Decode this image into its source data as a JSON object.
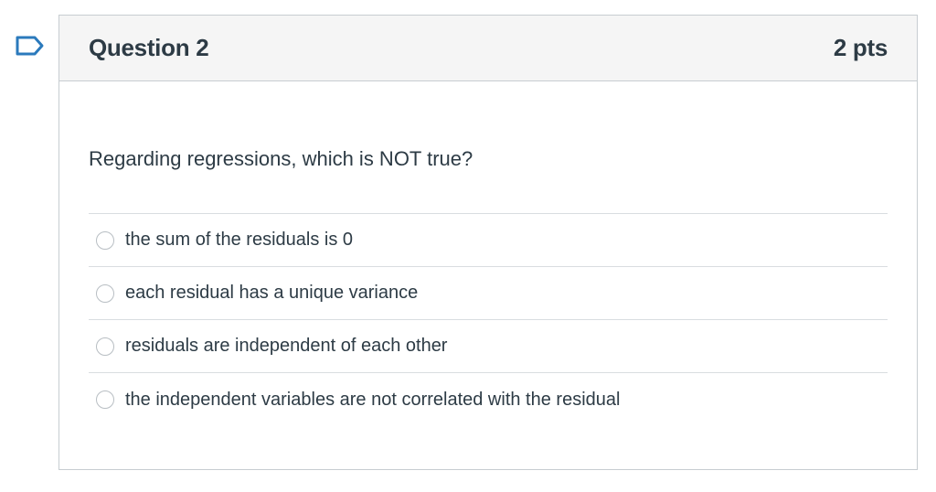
{
  "question": {
    "title": "Question 2",
    "points": "2 pts",
    "text": "Regarding regressions, which is NOT true?",
    "answers": [
      {
        "label": "the sum of the residuals is 0"
      },
      {
        "label": "each residual has a unique variance"
      },
      {
        "label": "residuals are independent of each other"
      },
      {
        "label": "the independent variables are not correlated with the residual"
      }
    ]
  },
  "icons": {
    "flag": "flag-question-icon"
  },
  "colors": {
    "text": "#2d3b45",
    "border": "#c7cdd1",
    "header_bg": "#f5f5f5",
    "flag": "#2b7abc"
  }
}
